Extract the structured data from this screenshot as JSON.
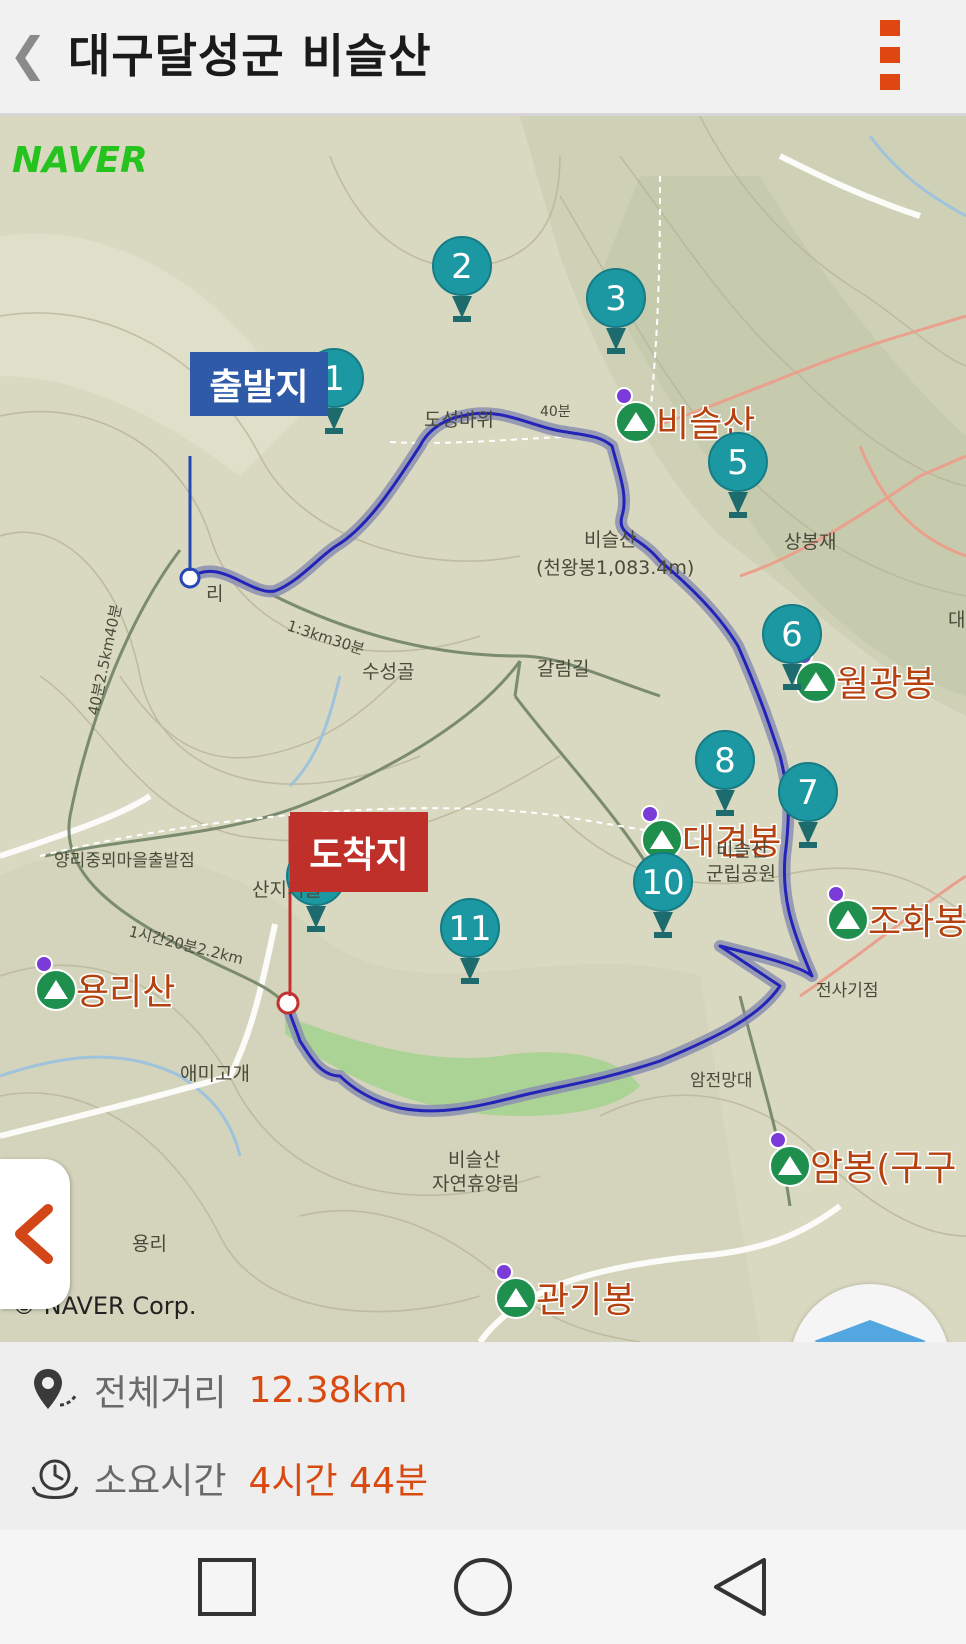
{
  "header": {
    "back_icon": "chevron-left-icon",
    "title": "대구달성군 비슬산",
    "menu_icon": "vertical-menu-icon",
    "accent_color": "#e0460f"
  },
  "map": {
    "brand_logo": "NAVER",
    "copyright": "© NAVER Corp.",
    "start_label": "출발지",
    "end_label": "도착지",
    "route_color": "#2323b8",
    "waypoints": [
      "1",
      "2",
      "3",
      "5",
      "6",
      "7",
      "8",
      "10",
      "11",
      "12"
    ],
    "peaks": [
      "비슬산",
      "월광봉",
      "대견봉",
      "조화봉",
      "용리산",
      "관기봉",
      "암봉(구구"
    ],
    "place_labels": [
      "도성바위",
      "비슬산",
      "(천왕봉1,083.4m)",
      "상봉재",
      "수성골",
      "갈림길",
      "양리중뫼마을출발점",
      "산지기골",
      "애미고개",
      "비슬산",
      "자연휴양림",
      "비슬산",
      "군립공원",
      "전사기점",
      "암전망대",
      "용리",
      "40분",
      "리",
      "1:3km30분",
      "40분2.5km40분",
      "1시간20분2.2km",
      "대"
    ],
    "layer_button_icon": "layers-icon",
    "side_tab_icon": "chevron-left-icon"
  },
  "summary": {
    "distance_label": "전체거리",
    "distance_value": "12.38km",
    "time_label": "소요시간",
    "time_value": "4시간 44분"
  },
  "navbar": {
    "recents_icon": "square-icon",
    "home_icon": "circle-icon",
    "back_icon": "triangle-back-icon"
  }
}
